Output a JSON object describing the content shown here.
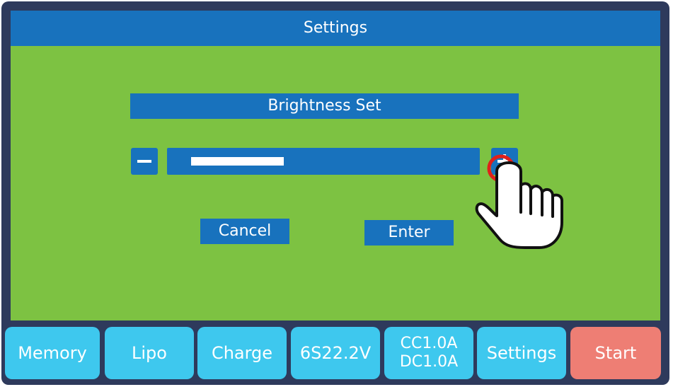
{
  "header": {
    "title": "Settings"
  },
  "dialog": {
    "title": "Brightness Set",
    "brightness_fraction": 0.35,
    "minus_icon": "minus-icon",
    "plus_icon": "plus-icon",
    "cancel_label": "Cancel",
    "enter_label": "Enter"
  },
  "footer": {
    "items": [
      {
        "label": "Memory"
      },
      {
        "label": "Lipo"
      },
      {
        "label": "Charge"
      },
      {
        "label": "6S22.2V"
      },
      {
        "line1": "CC1.0A",
        "line2": "DC1.0A"
      },
      {
        "label": "Settings"
      },
      {
        "label": "Start"
      }
    ]
  },
  "colors": {
    "screen_bg": "#7dc242",
    "accent_blue": "#1872bd",
    "footer_button": "#3ec8ee",
    "start_button": "#ee7e74",
    "frame": "#2e3a5c",
    "touch_indicator": "#e0201a"
  }
}
